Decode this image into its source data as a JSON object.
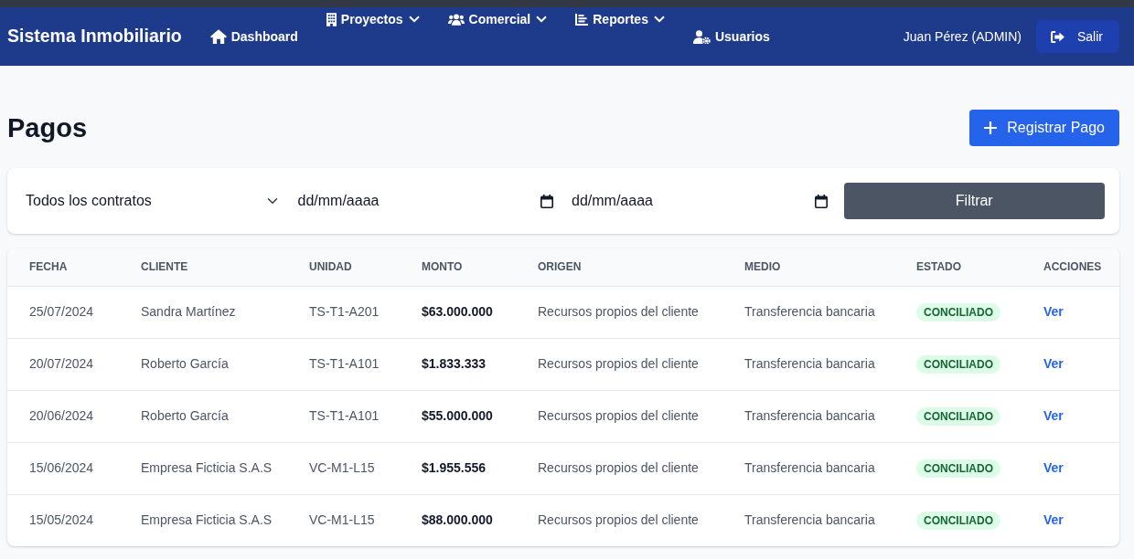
{
  "navbar": {
    "brand": "Sistema Inmobiliario",
    "items": [
      {
        "label": "Dashboard",
        "kind": "link"
      },
      {
        "label": "Proyectos",
        "kind": "dropdown"
      },
      {
        "label": "Comercial",
        "kind": "dropdown"
      },
      {
        "label": "Reportes",
        "kind": "dropdown"
      },
      {
        "label": "Usuarios",
        "kind": "link"
      }
    ],
    "user": "Juan Pérez (ADMIN)",
    "logout_button": "Salir"
  },
  "page": {
    "title": "Pagos",
    "primary_button": "Registrar Pago"
  },
  "filters": {
    "contract_select": {
      "value": "Todos los contratos"
    },
    "date_from": {
      "placeholder": "dd/mm/aaaa"
    },
    "date_to": {
      "placeholder": "dd/mm/aaaa"
    },
    "button": "Filtrar"
  },
  "table": {
    "columns": [
      "FECHA",
      "CLIENTE",
      "UNIDAD",
      "MONTO",
      "ORIGEN",
      "MEDIO",
      "ESTADO",
      "ACCIONES"
    ],
    "rows": [
      {
        "date": "25/07/2024",
        "client": "Sandra Martínez",
        "unit": "TS-T1-A201",
        "amount": "$63.000.000",
        "origin": "Recursos propios del cliente",
        "method": "Transferencia bancaria",
        "status": "CONCILIADO",
        "action": "Ver"
      },
      {
        "date": "20/07/2024",
        "client": "Roberto García",
        "unit": "TS-T1-A101",
        "amount": "$1.833.333",
        "origin": "Recursos propios del cliente",
        "method": "Transferencia bancaria",
        "status": "CONCILIADO",
        "action": "Ver"
      },
      {
        "date": "20/06/2024",
        "client": "Roberto García",
        "unit": "TS-T1-A101",
        "amount": "$55.000.000",
        "origin": "Recursos propios del cliente",
        "method": "Transferencia bancaria",
        "status": "CONCILIADO",
        "action": "Ver"
      },
      {
        "date": "15/06/2024",
        "client": "Empresa Ficticia S.A.S",
        "unit": "VC-M1-L15",
        "amount": "$1.955.556",
        "origin": "Recursos propios del cliente",
        "method": "Transferencia bancaria",
        "status": "CONCILIADO",
        "action": "Ver"
      },
      {
        "date": "15/05/2024",
        "client": "Empresa Ficticia S.A.S",
        "unit": "VC-M1-L15",
        "amount": "$88.000.000",
        "origin": "Recursos propios del cliente",
        "method": "Transferencia bancaria",
        "status": "CONCILIADO",
        "action": "Ver"
      }
    ]
  }
}
